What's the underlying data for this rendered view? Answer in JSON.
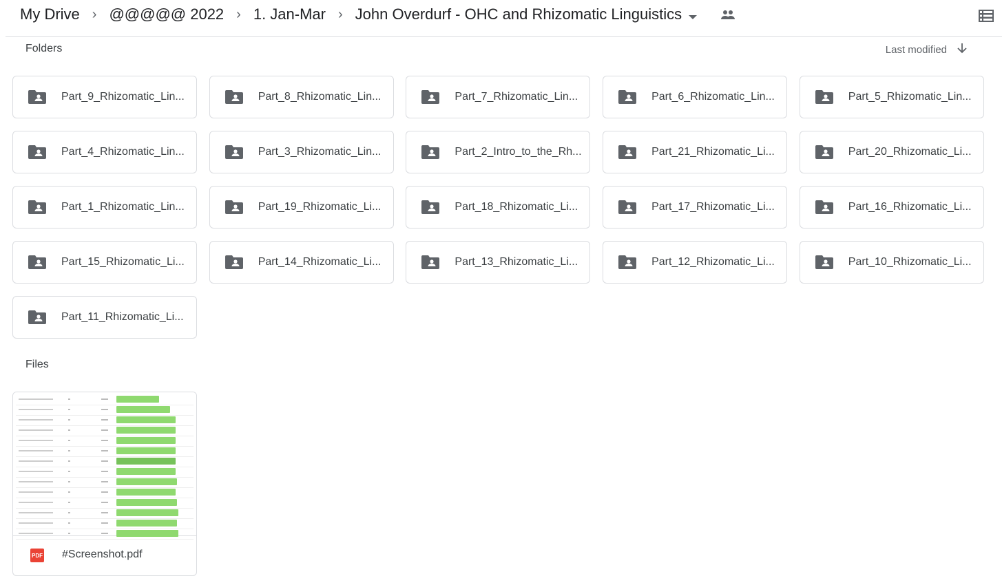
{
  "breadcrumb": [
    "My Drive",
    "@@@@@ 2022",
    "1. Jan-Mar",
    "John Overdurf - OHC and Rhizomatic Linguistics"
  ],
  "header": {
    "shared_icon": "people-icon",
    "view_icon": "list-view-icon"
  },
  "folders_label": "Folders",
  "sort": {
    "label": "Last modified",
    "direction": "descending"
  },
  "folders": [
    "Part_9_Rhizomatic_Lin...",
    "Part_8_Rhizomatic_Lin...",
    "Part_7_Rhizomatic_Lin...",
    "Part_6_Rhizomatic_Lin...",
    "Part_5_Rhizomatic_Lin...",
    "Part_4_Rhizomatic_Lin...",
    "Part_3_Rhizomatic_Lin...",
    "Part_2_Intro_to_the_Rh...",
    "Part_21_Rhizomatic_Li...",
    "Part_20_Rhizomatic_Li...",
    "Part_1_Rhizomatic_Lin...",
    "Part_19_Rhizomatic_Li...",
    "Part_18_Rhizomatic_Li...",
    "Part_17_Rhizomatic_Li...",
    "Part_16_Rhizomatic_Li...",
    "Part_15_Rhizomatic_Li...",
    "Part_14_Rhizomatic_Li...",
    "Part_13_Rhizomatic_Li...",
    "Part_12_Rhizomatic_Li...",
    "Part_10_Rhizomatic_Li...",
    "Part_11_Rhizomatic_Li..."
  ],
  "files_label": "Files",
  "files": [
    {
      "name": "#Screenshot.pdf",
      "type_badge": "PDF"
    }
  ],
  "colors": {
    "pdf_red": "#ea4335",
    "thumb_green": "#8fd96f",
    "border": "#dadce0"
  }
}
